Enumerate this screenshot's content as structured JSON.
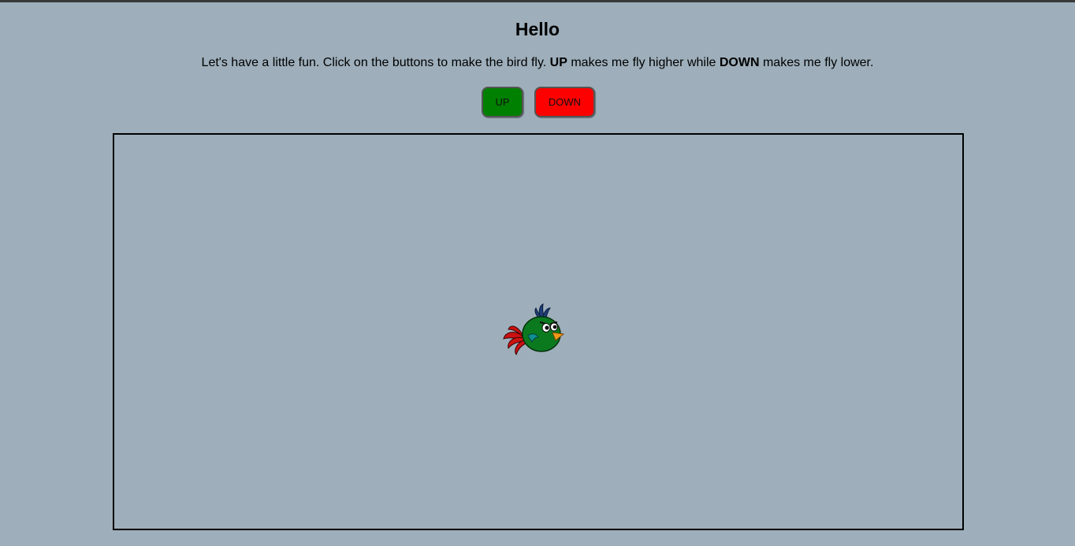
{
  "page": {
    "title": "Hello",
    "intro": {
      "part1": "Let's have a little fun. Click on the buttons to make the bird fly. ",
      "up_word": "UP",
      "part2": " makes me fly higher while ",
      "down_word": "DOWN",
      "part3": " makes me fly lower."
    }
  },
  "controls": {
    "up_label": "UP",
    "down_label": "DOWN",
    "up_color": "#008000",
    "down_color": "#ff0000"
  },
  "stage": {
    "border_color": "#000000",
    "background": "#9eafbb"
  },
  "bird": {
    "icon": "green-bird-icon",
    "body_color": "#0b7a1f",
    "tail_color": "#cc1111",
    "crest_color": "#1f3f7a",
    "beak_color": "#f29a1a"
  }
}
